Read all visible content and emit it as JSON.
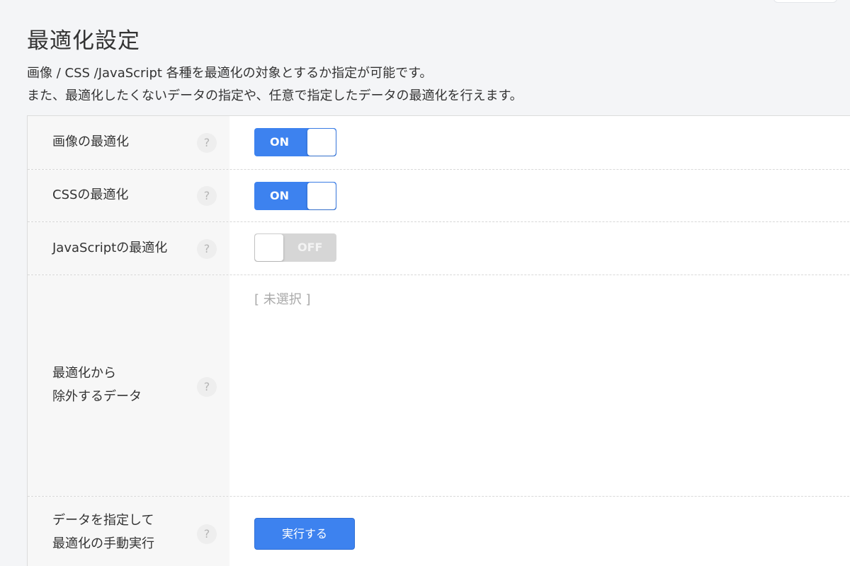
{
  "page": {
    "title": "最適化設定",
    "description_line1": "画像 / CSS /JavaScript 各種を最適化の対象とするか指定が可能です。",
    "description_line2": "また、最適化したくないデータの指定や、任意で指定したデータの最適化を行えます。"
  },
  "help_icon_glyph": "?",
  "settings": {
    "image": {
      "label": "画像の最適化",
      "toggle_label": "ON",
      "state": "on"
    },
    "css": {
      "label": "CSSの最適化",
      "toggle_label": "ON",
      "state": "on"
    },
    "javascript": {
      "label": "JavaScriptの最適化",
      "toggle_label": "OFF",
      "state": "off"
    },
    "exclude": {
      "label_line1": "最適化から",
      "label_line2": "除外するデータ",
      "value": "[ 未選択 ]"
    },
    "manual": {
      "label_line1": "データを指定して",
      "label_line2": "最適化の手動実行",
      "button_label": "実行する"
    }
  },
  "colors": {
    "accent": "#3d82ef",
    "toggle_off": "#d6d6d6",
    "label_bg": "#f7f7f7",
    "page_bg": "#f4f5f7"
  }
}
